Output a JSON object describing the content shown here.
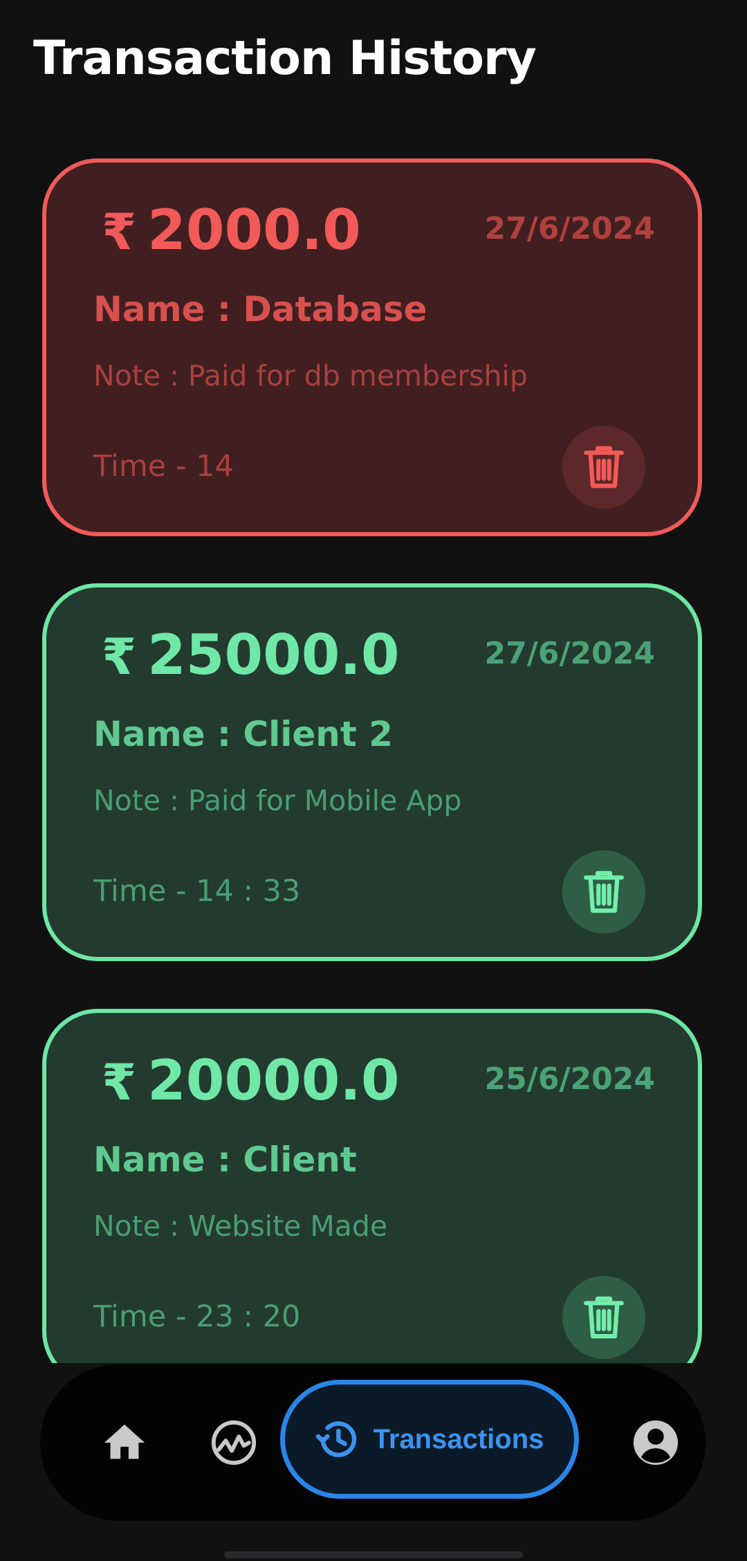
{
  "header": {
    "title": "Transaction History"
  },
  "currency_symbol": "₹",
  "transactions": [
    {
      "type": "debit",
      "amount": "2000.0",
      "date": "27/6/2024",
      "name": "Name : Database",
      "note": "Note : Paid for db membership",
      "time": "Time - 14"
    },
    {
      "type": "credit",
      "amount": "25000.0",
      "date": "27/6/2024",
      "name": "Name : Client 2",
      "note": "Note : Paid for Mobile App",
      "time": "Time - 14 : 33"
    },
    {
      "type": "credit",
      "amount": "20000.0",
      "date": "25/6/2024",
      "name": "Name : Client",
      "note": "Note : Website Made",
      "time": "Time - 23 : 20"
    }
  ],
  "bottom_nav": {
    "items": [
      {
        "icon": "home-icon",
        "label": "",
        "active": false
      },
      {
        "icon": "analytics-icon",
        "label": "",
        "active": false
      },
      {
        "icon": "history-icon",
        "label": "Transactions",
        "active": true
      },
      {
        "icon": "profile-icon",
        "label": "",
        "active": false
      }
    ]
  },
  "colors": {
    "background": "#111112",
    "debit_accent": "#f05a5a",
    "debit_card_bg": "#411f20",
    "credit_accent": "#6ee6a4",
    "credit_card_bg": "#233b2f",
    "nav_active": "#2a86e8",
    "nav_icon": "#c9c9c9"
  }
}
